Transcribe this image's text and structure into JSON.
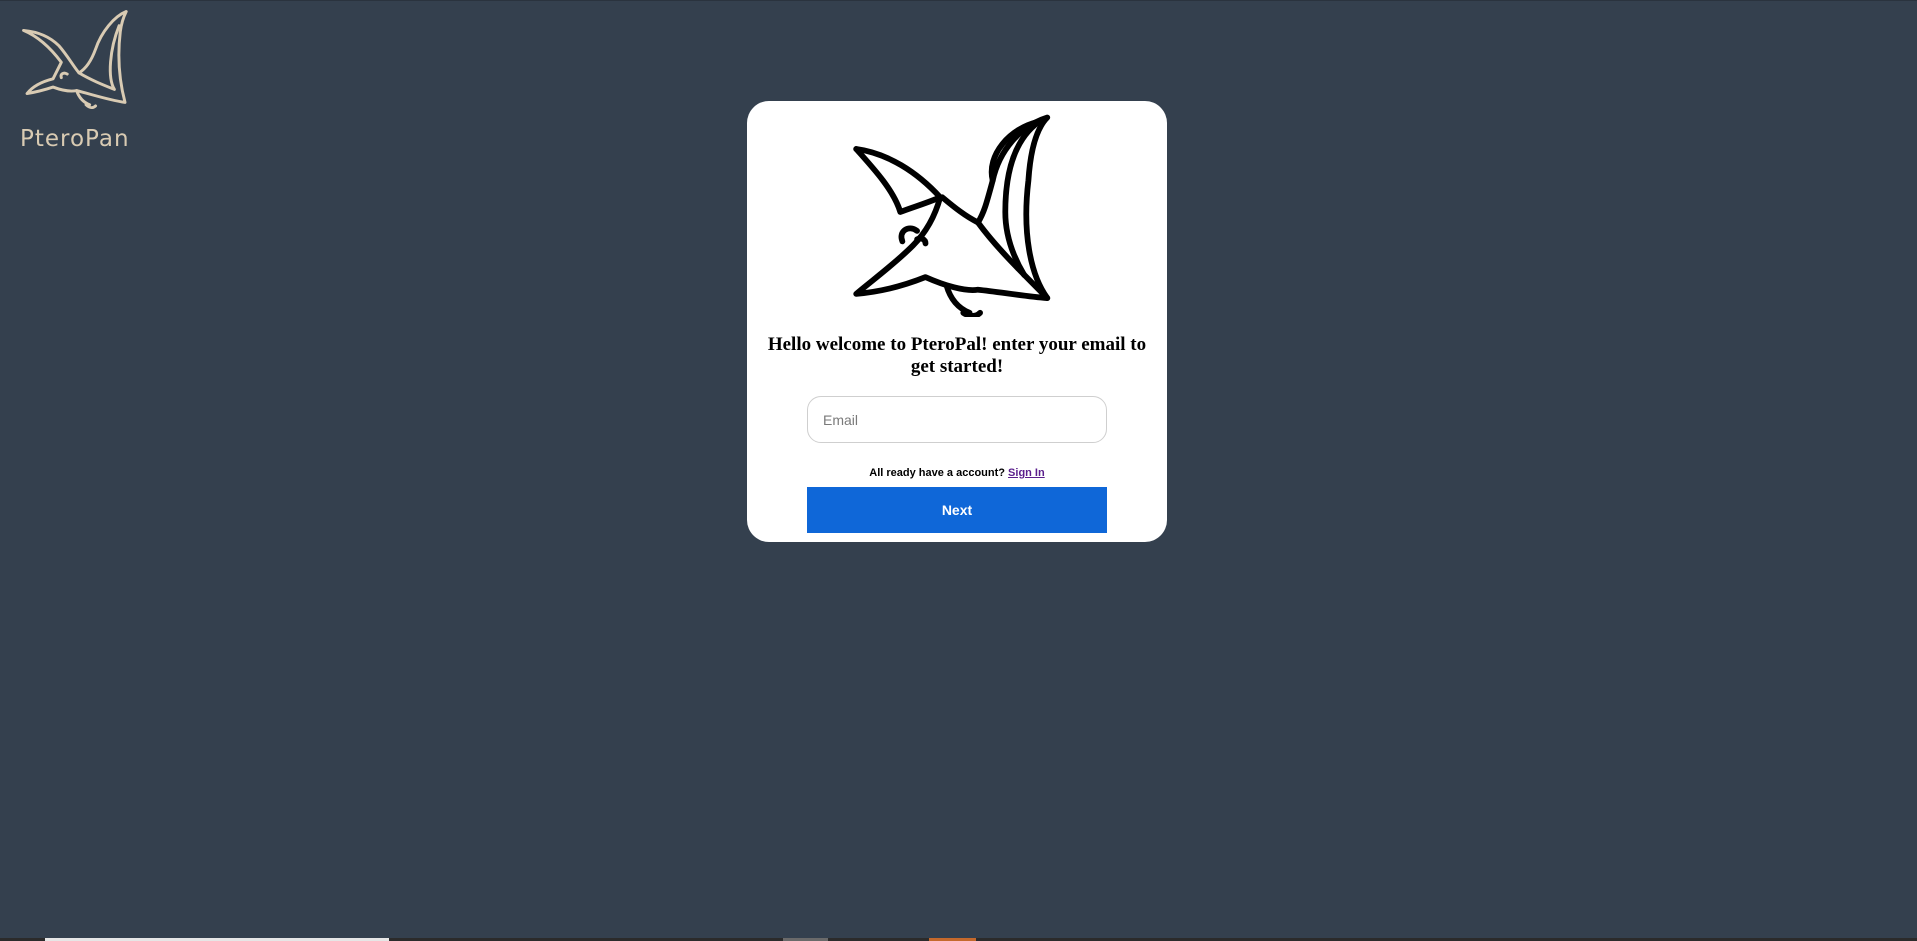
{
  "brand": {
    "name": "PteroPan",
    "logo_icon": "pterodactyl-logo-icon",
    "color": "#d9cbb3"
  },
  "card": {
    "hero_icon": "pterodactyl-icon",
    "welcome_text": "Hello welcome to PteroPal! enter your email to get started!",
    "email": {
      "value": "",
      "placeholder": "Email"
    },
    "account_prompt": "All ready have a account?",
    "sign_in_label": "Sign In",
    "next_label": "Next"
  },
  "colors": {
    "background": "#34404e",
    "card": "#ffffff",
    "primary_button": "#0f67d8",
    "link": "#5a1e8c"
  }
}
